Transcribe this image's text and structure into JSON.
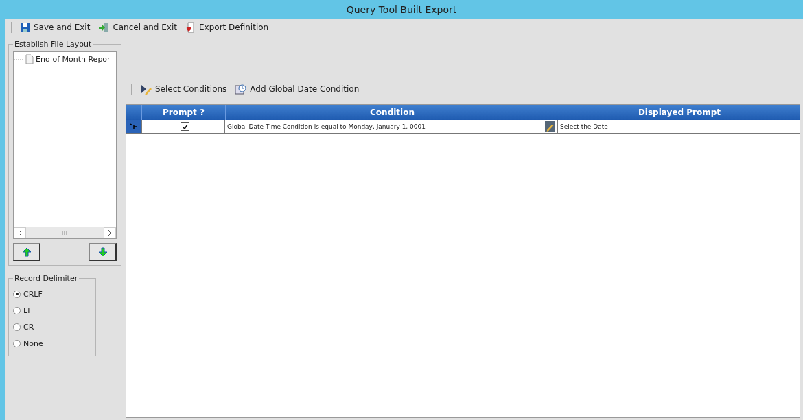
{
  "window": {
    "title": "Query Tool Built Export"
  },
  "toolbar": [
    {
      "kind": "save",
      "label": "Save and Exit"
    },
    {
      "kind": "cancel",
      "label": "Cancel and Exit"
    },
    {
      "kind": "export",
      "label": "Export Definition"
    }
  ],
  "file_layout": {
    "title": "Establish File Layout",
    "items": [
      {
        "label": "End of Month Repor"
      }
    ]
  },
  "record_delimiter": {
    "title": "Record Delimiter",
    "options": [
      {
        "label": "CRLF",
        "selected": true
      },
      {
        "label": "LF",
        "selected": false
      },
      {
        "label": "CR",
        "selected": false
      },
      {
        "label": "None",
        "selected": false
      }
    ]
  },
  "conditions_toolbar": [
    {
      "kind": "select",
      "label": "Select Conditions"
    },
    {
      "kind": "date",
      "label": "Add Global Date Condition"
    }
  ],
  "table": {
    "columns": [
      "Prompt ?",
      "Condition",
      "Displayed Prompt"
    ],
    "rows": [
      {
        "prompt": true,
        "condition": "Global Date Time Condition is equal to Monday, January 1, 0001",
        "displayed_prompt": "Select the Date",
        "current": true
      }
    ]
  }
}
